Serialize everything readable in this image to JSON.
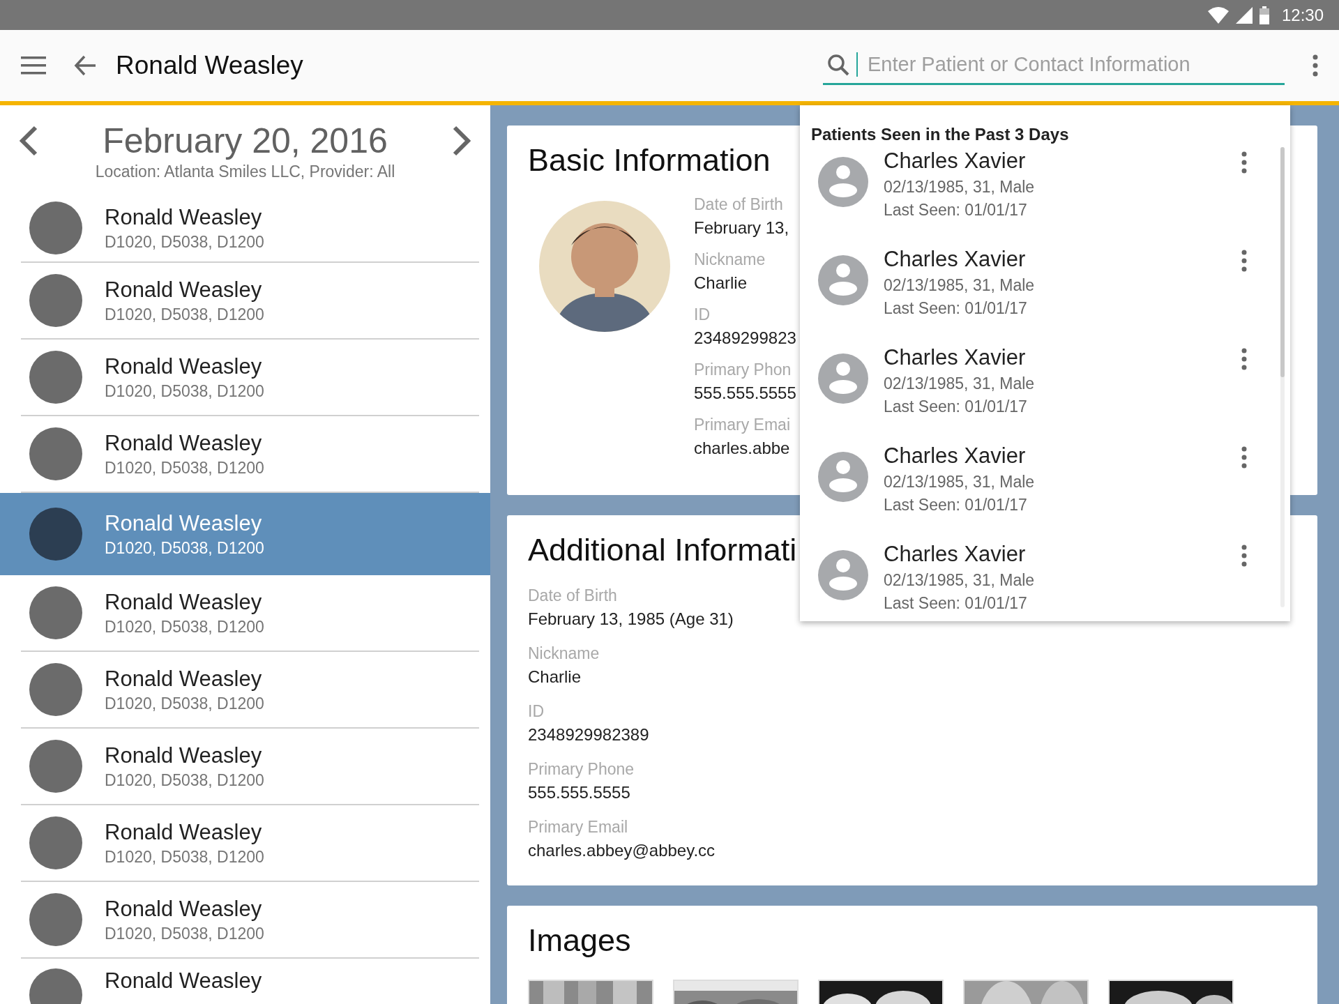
{
  "status_bar": {
    "time": "12:30"
  },
  "app_bar": {
    "title": "Ronald Weasley",
    "search": {
      "placeholder": "Enter Patient or Contact Information"
    }
  },
  "schedule": {
    "date": "February 20, 2016",
    "subtitle": "Location: Atlanta Smiles LLC, Provider: All",
    "patients": [
      {
        "name": "Ronald Weasley",
        "codes": "D1020, D5038, D1200",
        "selected": false
      },
      {
        "name": "Ronald Weasley",
        "codes": "D1020, D5038, D1200",
        "selected": false
      },
      {
        "name": "Ronald Weasley",
        "codes": "D1020, D5038, D1200",
        "selected": false
      },
      {
        "name": "Ronald Weasley",
        "codes": "D1020, D5038, D1200",
        "selected": false
      },
      {
        "name": "Ronald Weasley",
        "codes": "D1020, D5038, D1200",
        "selected": true
      },
      {
        "name": "Ronald Weasley",
        "codes": "D1020, D5038, D1200",
        "selected": false
      },
      {
        "name": "Ronald Weasley",
        "codes": "D1020, D5038, D1200",
        "selected": false
      },
      {
        "name": "Ronald Weasley",
        "codes": "D1020, D5038, D1200",
        "selected": false
      },
      {
        "name": "Ronald Weasley",
        "codes": "D1020, D5038, D1200",
        "selected": false
      },
      {
        "name": "Ronald Weasley",
        "codes": "D1020, D5038, D1200",
        "selected": false
      },
      {
        "name": "Ronald Weasley",
        "selected": false
      }
    ]
  },
  "basic_information": {
    "title": "Basic Information",
    "fields": [
      {
        "label": "Date of Birth",
        "value": "February 13,"
      },
      {
        "label": "Nickname",
        "value": "Charlie"
      },
      {
        "label": "ID",
        "value": "23489299823"
      },
      {
        "label": "Primary Phon",
        "value": "555.555.5555"
      },
      {
        "label": "Primary Emai",
        "value": "charles.abbe"
      }
    ]
  },
  "additional_information": {
    "title": "Additional Informati",
    "fields": [
      {
        "label": "Date of Birth",
        "value": "February 13, 1985 (Age 31)"
      },
      {
        "label": "Nickname",
        "value": "Charlie"
      },
      {
        "label": "ID",
        "value": "2348929982389"
      },
      {
        "label": "Primary Phone",
        "value": "555.555.5555"
      },
      {
        "label": "Primary Email",
        "value": "charles.abbey@abbey.cc"
      }
    ]
  },
  "images": {
    "title": "Images"
  },
  "recent_patients": {
    "title": "Patients Seen in the Past 3 Days",
    "patients": [
      {
        "name": "Charles Xavier",
        "details": "02/13/1985, 31, Male",
        "last_seen": "Last Seen: 01/01/17"
      },
      {
        "name": "Charles Xavier",
        "details": "02/13/1985, 31, Male",
        "last_seen": "Last Seen: 01/01/17"
      },
      {
        "name": "Charles Xavier",
        "details": "02/13/1985, 31, Male",
        "last_seen": "Last Seen: 01/01/17"
      },
      {
        "name": "Charles Xavier",
        "details": "02/13/1985, 31, Male",
        "last_seen": "Last Seen: 01/01/17"
      },
      {
        "name": "Charles Xavier",
        "details": "02/13/1985, 31, Male",
        "last_seen": "Last Seen: 01/01/17"
      }
    ]
  }
}
